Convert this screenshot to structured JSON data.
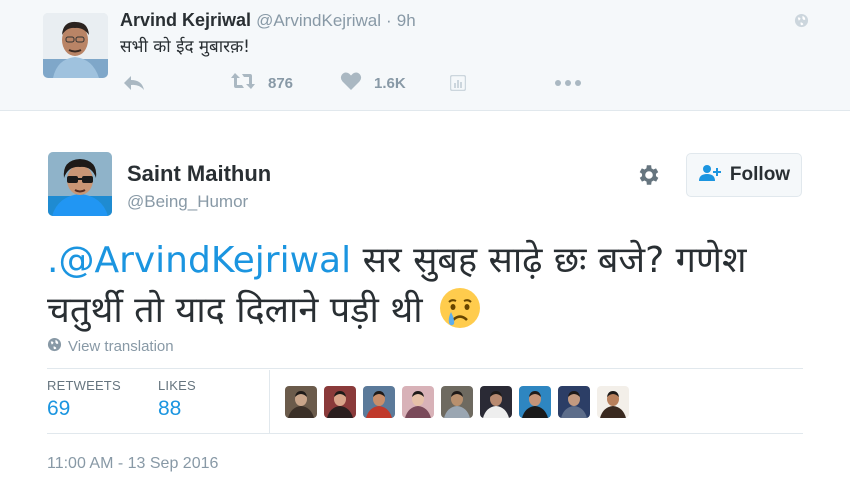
{
  "parent_tweet": {
    "author_name": "Arvind Kejriwal",
    "author_handle": "@ArvindKejriwal",
    "separator": "·",
    "time": "9h",
    "text": "सभी को ईद मुबारक़!",
    "actions": {
      "reply_icon": "reply-icon",
      "retweet_icon": "retweet-icon",
      "retweet_count": "876",
      "like_icon": "heart-icon",
      "like_count": "1.6K",
      "analytics_icon": "analytics-icon",
      "more_icon": "more-icon"
    }
  },
  "tweet": {
    "author_name": "Saint Maithun",
    "author_handle": "@Being_Humor",
    "follow_label": "Follow",
    "text_mention": ".@ArvindKejriwal",
    "text_body": " सर सुबह साढ़े छः बजे? गणेश चतुर्थी तो याद दिलाने पड़ी थी",
    "emoji": "crying-face-emoji",
    "translate_label": "View translation",
    "stats": {
      "retweets_label": "RETWEETS",
      "retweets": "69",
      "likes_label": "LIKES",
      "likes": "88",
      "liker_avatar_count": 9
    },
    "timestamp": "11:00 AM - 13 Sep 2016"
  },
  "colors": {
    "link_blue": "#1b95e0",
    "muted_gray": "#8899a6",
    "text_dark": "#292f33",
    "parent_bg": "#f5f8fa",
    "border": "#e1e8ed"
  }
}
